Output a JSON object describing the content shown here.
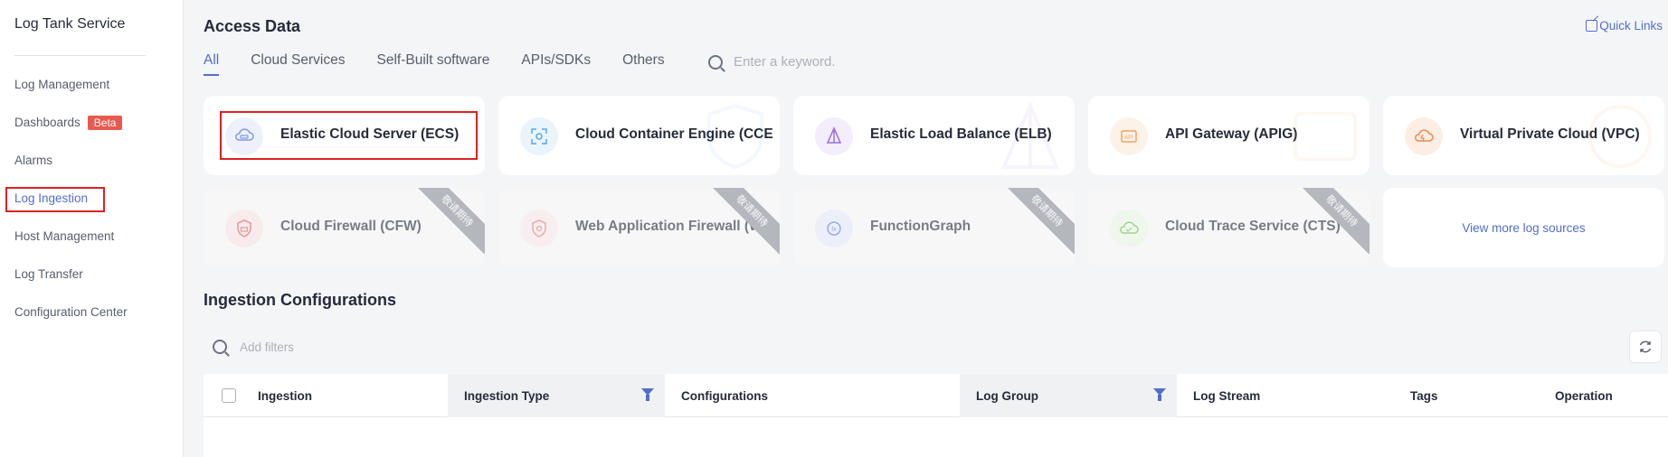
{
  "sidebar": {
    "title": "Log Tank Service",
    "items": [
      {
        "label": "Log Management"
      },
      {
        "label": "Dashboards",
        "badge": "Beta"
      },
      {
        "label": "Alarms"
      },
      {
        "label": "Log Ingestion"
      },
      {
        "label": "Host Management"
      },
      {
        "label": "Log Transfer"
      },
      {
        "label": "Configuration Center"
      }
    ]
  },
  "access": {
    "title": "Access Data",
    "quick_links": "Quick Links",
    "tabs": [
      "All",
      "Cloud Services",
      "Self-Built software",
      "APIs/SDKs",
      "Others"
    ],
    "search_placeholder": "Enter a keyword.",
    "cards": [
      {
        "label": "Elastic Cloud Server (ECS)",
        "icon": "ecs-icon",
        "color": "#7e9ae8"
      },
      {
        "label": "Cloud Container Engine (CCE",
        "icon": "cce-icon",
        "color": "#5aa6e8"
      },
      {
        "label": "Elastic Load Balance (ELB)",
        "icon": "elb-icon",
        "color": "#9a6fe0"
      },
      {
        "label": "API Gateway (APIG)",
        "icon": "apig-icon",
        "color": "#f5a35a"
      },
      {
        "label": "Virtual Private Cloud (VPC)",
        "icon": "vpc-icon",
        "color": "#f08a4b"
      },
      {
        "label": "Cloud Firewall (CFW)",
        "icon": "cfw-icon",
        "color": "#e05a5a",
        "ribbon": "敬请期待"
      },
      {
        "label": "Web Application Firewall (W",
        "icon": "waf-icon",
        "color": "#e87a7a",
        "ribbon": "敬请期待"
      },
      {
        "label": "FunctionGraph",
        "icon": "functiongraph-icon",
        "color": "#5a7ae0",
        "ribbon": "敬请期待"
      },
      {
        "label": "Cloud Trace Service (CTS)",
        "icon": "cts-icon",
        "color": "#6cc04a",
        "ribbon": "敬请期待"
      }
    ],
    "view_more": "View more log sources"
  },
  "ingestion": {
    "title": "Ingestion Configurations",
    "filter_placeholder": "Add filters",
    "columns": [
      "Ingestion",
      "Ingestion Type",
      "Configurations",
      "Log Group",
      "Log Stream",
      "Tags",
      "Operation"
    ]
  }
}
